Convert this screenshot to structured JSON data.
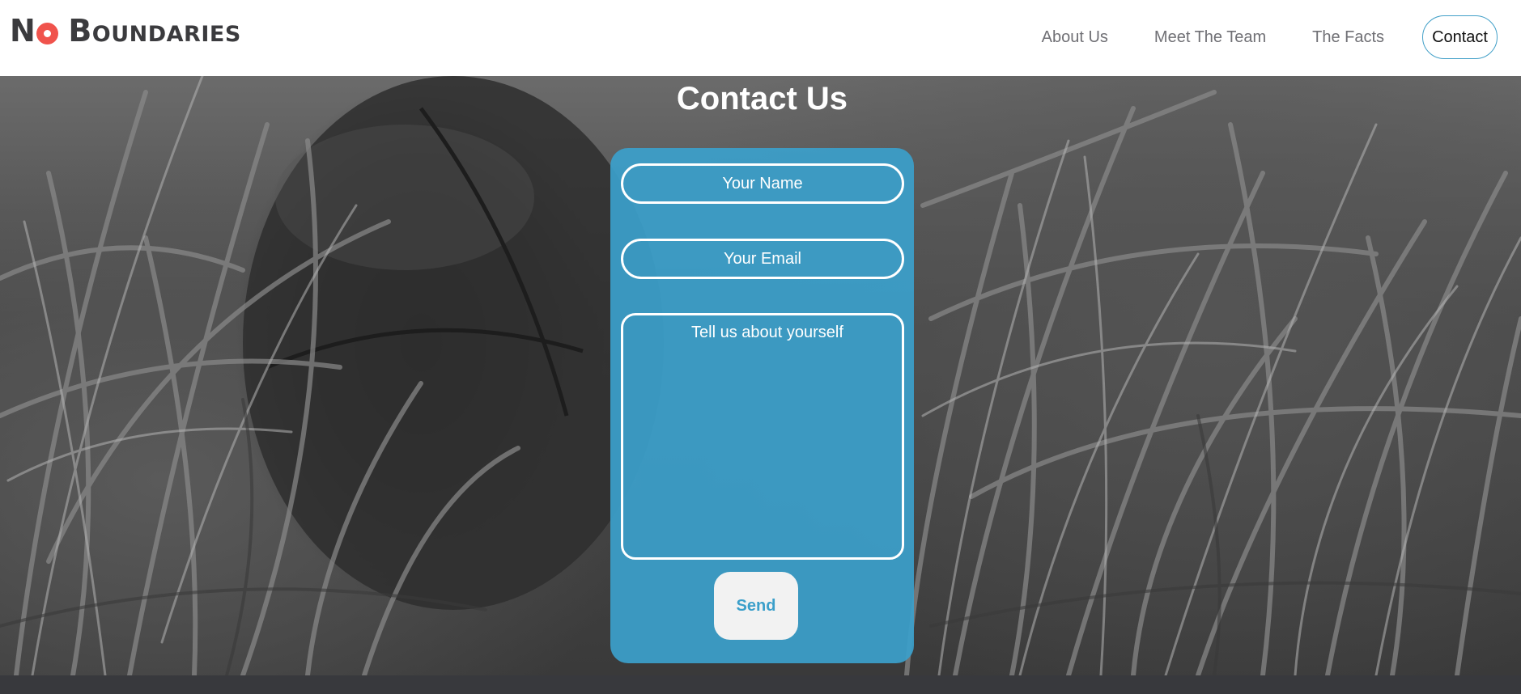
{
  "header": {
    "logo_first": "N",
    "logo_rest": "Boundaries",
    "nav": [
      {
        "label": "About Us"
      },
      {
        "label": "Meet The Team"
      },
      {
        "label": "The Facts"
      },
      {
        "label": "Contact"
      }
    ]
  },
  "main": {
    "title": "Contact Us",
    "form": {
      "name_placeholder": "Your Name",
      "email_placeholder": "Your Email",
      "message_placeholder": "Tell us about yourself",
      "send_label": "Send"
    }
  },
  "colors": {
    "accent": "#3b9fca",
    "logo_red": "#f0534c",
    "header_bg": "#ffffff",
    "footer_bg": "#38393d"
  }
}
